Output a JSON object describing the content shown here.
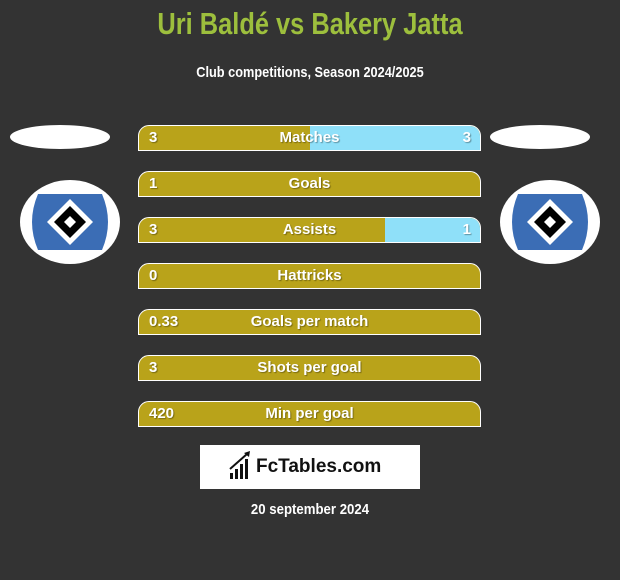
{
  "header": {
    "title": "Uri Baldé vs Bakery Jatta",
    "subtitle": "Club competitions, Season 2024/2025"
  },
  "players": {
    "left": {
      "badge_icon": "hsv-club-crest-icon"
    },
    "right": {
      "badge_icon": "hsv-club-crest-icon"
    }
  },
  "colors": {
    "left_bar": "#b9a31a",
    "right_bar": "#8fe0f9",
    "title": "#9dbf3d",
    "background": "#333333"
  },
  "stats": [
    {
      "label": "Matches",
      "left": "3",
      "right": "3",
      "right_share": 0.5
    },
    {
      "label": "Goals",
      "left": "1",
      "right": "",
      "right_share": 0
    },
    {
      "label": "Assists",
      "left": "3",
      "right": "1",
      "right_share": 0.28
    },
    {
      "label": "Hattricks",
      "left": "0",
      "right": "",
      "right_share": 0
    },
    {
      "label": "Goals per match",
      "left": "0.33",
      "right": "",
      "right_share": 0
    },
    {
      "label": "Shots per goal",
      "left": "3",
      "right": "",
      "right_share": 0
    },
    {
      "label": "Min per goal",
      "left": "420",
      "right": "",
      "right_share": 0
    }
  ],
  "brand": {
    "name": "FcTables.com",
    "icon": "bar-chart-icon"
  },
  "footer": {
    "date": "20 september 2024"
  }
}
